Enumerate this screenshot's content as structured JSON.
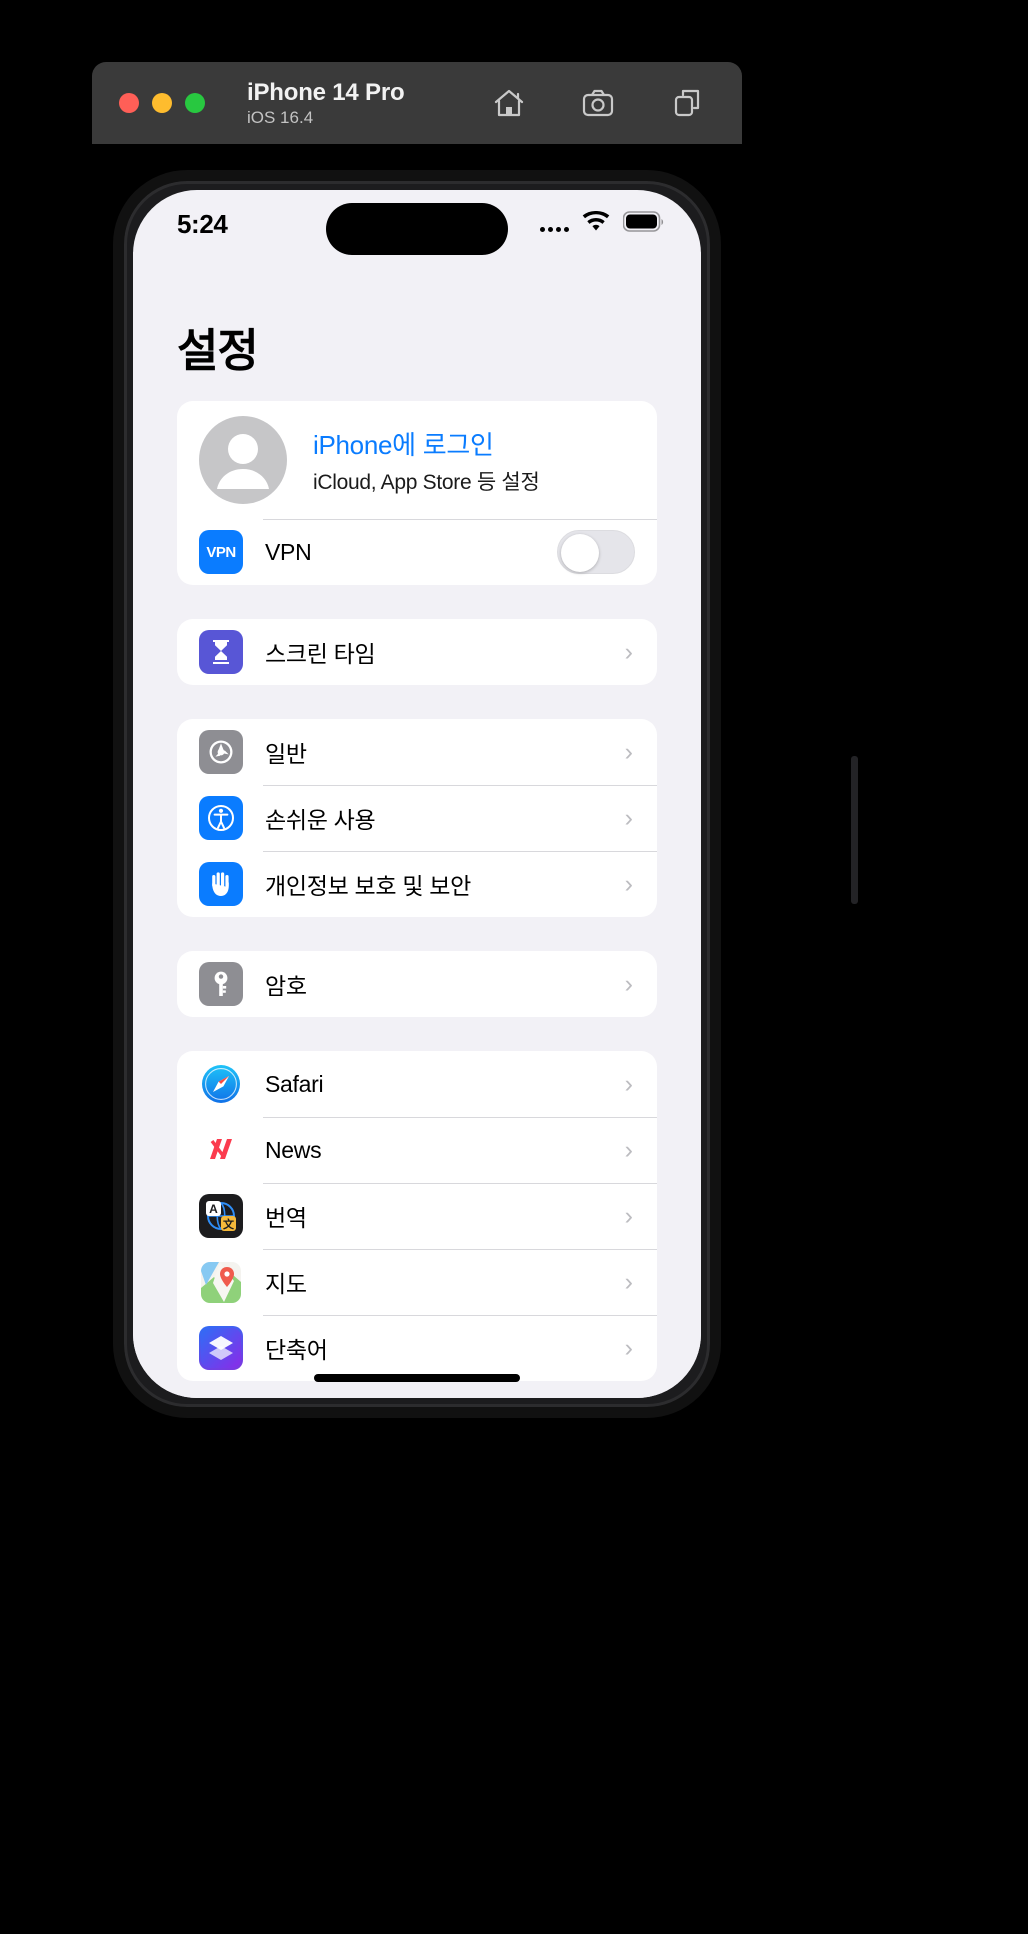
{
  "simulator": {
    "device_name": "iPhone 14 Pro",
    "os_version": "iOS 16.4",
    "toolbar": [
      {
        "name": "home-icon",
        "label": "Home"
      },
      {
        "name": "screenshot-icon",
        "label": "Screenshot"
      },
      {
        "name": "rotate-icon",
        "label": "Rotate"
      }
    ]
  },
  "status_bar": {
    "time": "5:24",
    "wifi_icon": "wifi-icon",
    "battery_icon": "battery-icon"
  },
  "settings": {
    "page_title": "설정",
    "account": {
      "title": "iPhone에 로그인",
      "subtitle": "iCloud, App Store 등 설정",
      "avatar_icon": "person-avatar-icon"
    },
    "groups": [
      {
        "id": "account-group",
        "rows": [
          {
            "type": "toggle",
            "icon": "vpn-icon",
            "icon_class": "ic-vpn",
            "icon_text": "VPN",
            "label": "VPN",
            "value": "off"
          }
        ]
      },
      {
        "id": "screentime-group",
        "rows": [
          {
            "type": "nav",
            "icon": "hourglass-icon",
            "icon_class": "ic-screentime",
            "label": "스크린 타임"
          }
        ]
      },
      {
        "id": "system-group",
        "rows": [
          {
            "type": "nav",
            "icon": "gear-icon",
            "icon_class": "ic-general",
            "label": "일반"
          },
          {
            "type": "nav",
            "icon": "accessibility-icon",
            "icon_class": "ic-access",
            "label": "손쉬운 사용"
          },
          {
            "type": "nav",
            "icon": "hand-raised-icon",
            "icon_class": "ic-privacy",
            "label": "개인정보 보호 및 보안"
          }
        ]
      },
      {
        "id": "passwords-group",
        "rows": [
          {
            "type": "nav",
            "icon": "key-icon",
            "icon_class": "ic-passwords",
            "label": "암호"
          }
        ]
      },
      {
        "id": "apps-group",
        "rows": [
          {
            "type": "nav",
            "icon": "safari-compass-icon",
            "icon_class": "ic-safari",
            "label": "Safari"
          },
          {
            "type": "nav",
            "icon": "news-icon",
            "icon_class": "ic-news",
            "label": "News"
          },
          {
            "type": "nav",
            "icon": "translate-icon",
            "icon_class": "ic-translate",
            "label": "번역"
          },
          {
            "type": "nav",
            "icon": "maps-icon",
            "icon_class": "ic-maps",
            "label": "지도"
          },
          {
            "type": "nav",
            "icon": "shortcuts-icon",
            "icon_class": "ic-shortcuts",
            "label": "단축어"
          }
        ]
      }
    ],
    "chevron_glyph": "›"
  },
  "colors": {
    "accent_blue": "#0a7cff",
    "purple": "#5856d6",
    "gray_icon": "#8e8e93",
    "page_bg": "#f2f1f6",
    "card_bg": "#ffffff"
  }
}
